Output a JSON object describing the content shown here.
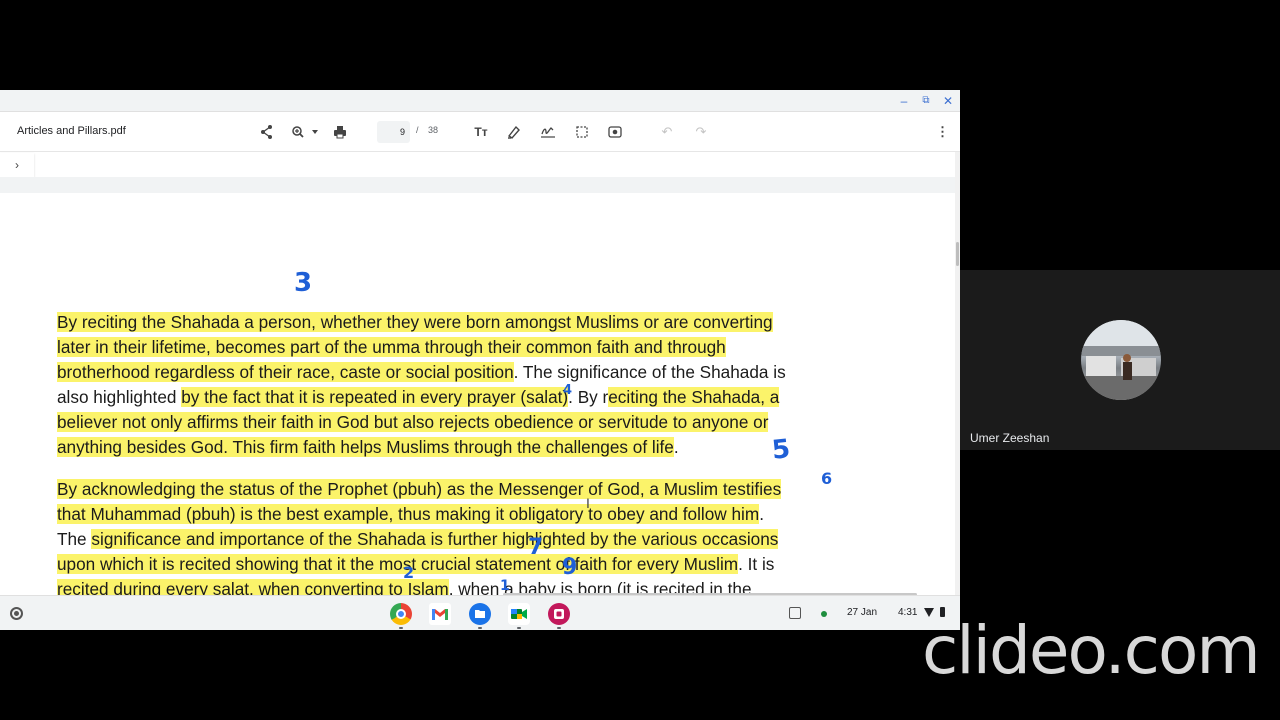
{
  "window": {
    "title": "Articles and Pillars.pdf",
    "controls": {
      "minimize": "–",
      "maximize": "⧉",
      "close": "✕"
    }
  },
  "toolbar": {
    "page_current": "9",
    "page_separator": "/",
    "page_total": "38",
    "icons": [
      "share-icon",
      "zoom-icon",
      "print-icon",
      "text-size-icon",
      "highlighter-icon",
      "signature-icon",
      "select-icon",
      "screenshot-icon",
      "undo-icon",
      "redo-icon",
      "more-icon"
    ]
  },
  "document": {
    "paragraph1": [
      [
        {
          "t": "By reciting the Shahada a person, whether they were born amongst Muslims or are converting",
          "h": true
        }
      ],
      [
        {
          "t": "later in their lifetime, becomes part of the umma through their common faith and through",
          "h": true
        }
      ],
      [
        {
          "t": "brotherhood regardless of their race, caste or social position",
          "h": true
        },
        {
          "t": ". The significance of the Shahada is",
          "h": false
        }
      ],
      [
        {
          "t": "also highlighted ",
          "h": false
        },
        {
          "t": "by the fact that it is repeated in every prayer (salat)",
          "h": true
        },
        {
          "t": ". By r",
          "h": false
        },
        {
          "t": "eciting the Shahada, a",
          "h": true
        }
      ],
      [
        {
          "t": "believer not only affirms their faith in God but also rejects obedience or servitude to anyone or",
          "h": true
        }
      ],
      [
        {
          "t": "anything besides God. This firm faith helps Muslims through the challenges of life",
          "h": true
        },
        {
          "t": ".",
          "h": false
        }
      ]
    ],
    "paragraph2": [
      [
        {
          "t": "By acknowledging the status of the Prophet (pbuh) as the Messenger of God, a Muslim testifies",
          "h": true
        }
      ],
      [
        {
          "t": "that Muhammad (pbuh) is the best example, thus making it obligatory to obey and follow him",
          "h": true
        },
        {
          "t": ".",
          "h": false
        }
      ],
      [
        {
          "t": "The ",
          "h": false
        },
        {
          "t": "significance and importance of the Shahada is further highlighted by the various occasions",
          "h": true
        }
      ],
      [
        {
          "t": "upon which it is recited showing that it the most crucial statement of faith for every Muslim",
          "h": true
        },
        {
          "t": ". It is",
          "h": false
        }
      ],
      [
        {
          "t": "recited during every salat, when converting to Islam",
          "h": true
        },
        {
          "t": ", when a baby is born (it is recited in the",
          "h": false
        }
      ]
    ],
    "annotations": [
      "3",
      "4",
      "5",
      "6",
      "7",
      "2",
      "1",
      "9"
    ]
  },
  "shelf": {
    "apps": [
      "chrome-icon",
      "gmail-icon",
      "files-icon",
      "meet-icon",
      "screencast-icon"
    ],
    "date": "27 Jan",
    "time": "4:31"
  },
  "participant": {
    "name": "Umer Zeeshan"
  },
  "watermark": "clideo.com"
}
